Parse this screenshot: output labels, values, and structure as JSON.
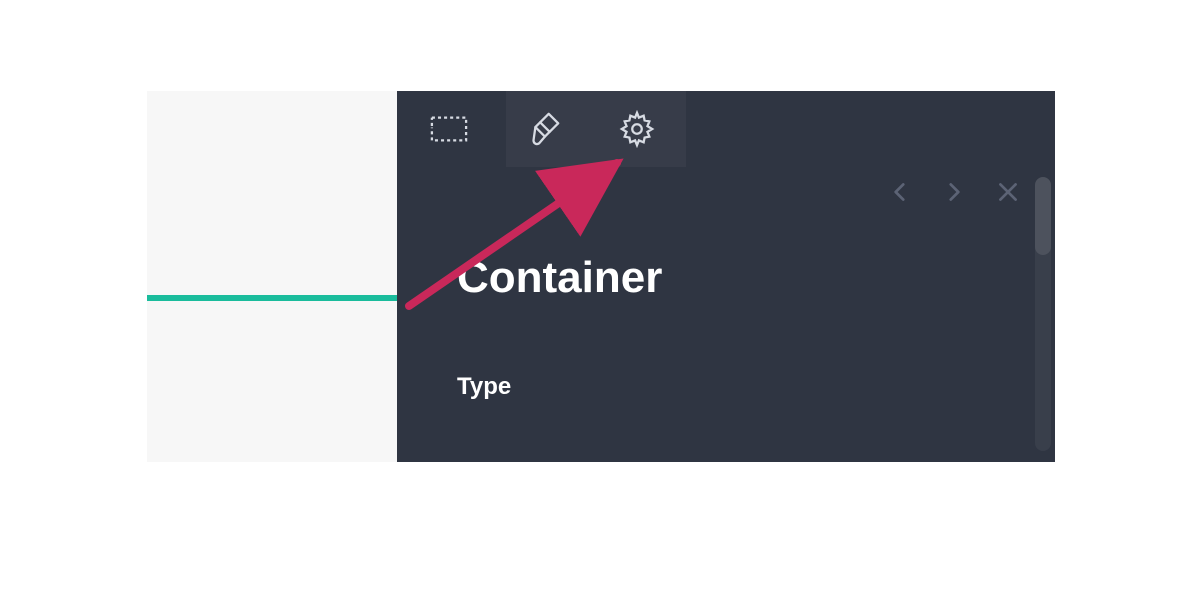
{
  "panel": {
    "tabs": [
      {
        "name": "selection",
        "active": false
      },
      {
        "name": "style",
        "active": true
      },
      {
        "name": "settings",
        "active": false
      }
    ],
    "title": "Container",
    "fields": {
      "type_label": "Type"
    },
    "nav": {
      "prev": "‹",
      "next": "›",
      "close": "×"
    }
  },
  "annotation": {
    "arrow_color": "#c9285a"
  }
}
